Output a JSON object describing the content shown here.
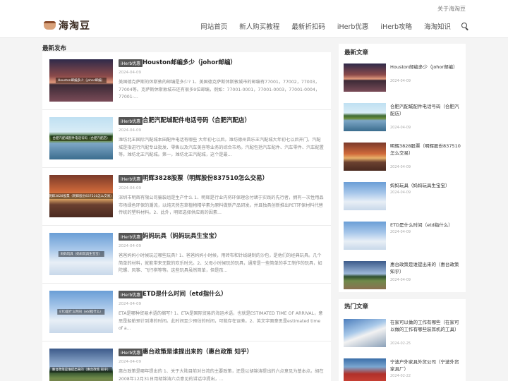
{
  "topbar": {
    "about": "关于海淘豆"
  },
  "header": {
    "logo_text": "海淘豆",
    "nav": [
      "网站首页",
      "新人购买教程",
      "最新折扣码",
      "iHerb优惠",
      "iHerb攻略",
      "海淘知识"
    ]
  },
  "latest_title": "最新发布",
  "posts": [
    {
      "tag": "iHerb优惠",
      "title": "Houston邮编多少（johor邮编）",
      "date": "2024-04-09",
      "thumb_caption": "Houston邮编多少（johor邮编）",
      "excerpt": "美国德克萨斯的休斯敦的邮编是多少? 1、美国德克萨斯休斯敦城市的邮编有77001，77002，77003，77004等。克萨斯休斯敦城市还有很多9位邮编，例如：77001-0001，77001-0003，77001-0004，77001-..."
    },
    {
      "tag": "iHerb优惠",
      "title": "合肥汽配城配件电话号码（合肥汽配店）",
      "date": "2024-04-09",
      "thumb_caption": "合肥汽配城配件电话号码（合肥汽配店）",
      "excerpt": "潍坊北王国际汽配城本田配件电话有哪些 大年初七以后。潍坊德州昌乐王汽配城大年初七以后开门。汽配城是指进行汽配专业批发、零售以及汽车美容等业务的综合市场。汽配包括汽车配件、汽车零件、汽车配置等。潍坊北王汽配城。第一，潍坊北王汽配城，这个是最..."
    },
    {
      "tag": "iHerb优惠",
      "title": "明辉3828股票（明辉股份837510怎么交易）",
      "date": "2024-04-09",
      "thumb_caption": "明辉3828股票（明辉股份837510怎么交易）",
      "excerpt": "深圳市明辉有限公司骗装组是生产什么 1、明辉是行业内将环保理念付诸于实践的先行者，拥有一次性用品市场绿色环保的潮流，以纯天然吉草植物精华素为原料做新产品研发。并且独具创新推出PET环保材料代替传统的塑料材料。2、此外，明辉选择供应商的因素..."
    },
    {
      "tag": "iHerb优惠",
      "title": "妈妈玩具（妈妈玩具生宝宝）",
      "date": "2024-04-09",
      "thumb_caption": "妈妈玩具（妈妈玩具生宝宝）",
      "excerpt": "爸爸妈妈小时候玩过哪些玩具? 1、爸爸妈妈小时候，用砖布和针线缝制的沙包，是他们的经典玩具。几个简单的材料，就能带来无数的欢乐时光。2、父母小时候玩的玩具，通常是一些简单的手工制作的玩具，如陀螺、风筝、飞行棋等等。这些玩具虽然简单，但是孩..."
    },
    {
      "tag": "iHerb优惠",
      "title": "ETD是什么时间（etd指什么）",
      "date": "2024-04-09",
      "thumb_caption": "ETD是什么时间（etd指什么）",
      "excerpt": "ETA是哪种贸易术语的缩写? 1、ETA是国际贸易的海运术语，也就是ESTIMATED TIME OF ARRIVAL，意思是船舶预计到港的时间。此时间至少预估的时间，可能存在误差。2、英文字面意思是estimated time of a..."
    },
    {
      "tag": "iHerb优惠",
      "title": "惠台政策是谁提出来的（惠台政策 知乎）",
      "date": "2024-04-09",
      "thumb_caption": "惠台政策是谁提出来的（惠台政策 知乎）",
      "excerpt": "惠台政策是哪年提出的 1、关于大陆目前对台湾的主要政策，还是以胡锦涛提出的六点意见为基本点。胡在2008年12月31日用胡锦涛六点意见的讲话中提出，..."
    }
  ],
  "sidebar_latest_title": "最新文章",
  "sidebar_latest": [
    {
      "title": "Houston邮编多少（johor邮编）",
      "date": "2024-04-09"
    },
    {
      "title": "合肥汽配城配件电话号码（合肥汽配店）",
      "date": "2024-04-09"
    },
    {
      "title": "明辉3828股票（明辉股份837510怎么交易）",
      "date": "2024-04-09"
    },
    {
      "title": "妈妈玩具（妈妈玩具生宝宝）",
      "date": "2024-04-09"
    },
    {
      "title": "ETD是什么时间（etd指什么）",
      "date": "2024-04-09"
    },
    {
      "title": "惠台政策是谁提出来的（惠台政策 知乎）",
      "date": "2024-04-09"
    }
  ],
  "sidebar_hot_title": "热门文章",
  "sidebar_hot": [
    {
      "title": "在家可以做的工作有哪些（在家可以做的工作有哪些装耳机的工具）",
      "date": "2024-02-25"
    },
    {
      "title": "宁波户外家具外贸公司（宁波外贸家具厂）",
      "date": "2024-02-22"
    }
  ]
}
